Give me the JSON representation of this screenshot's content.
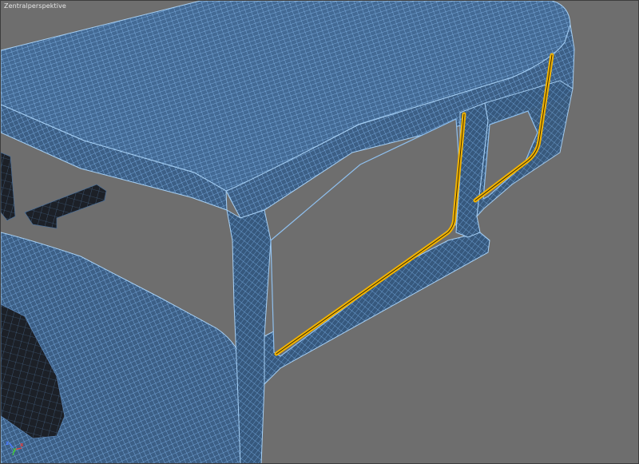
{
  "viewport": {
    "label": "Zentralperspektive"
  },
  "axis_gizmo": {
    "x_label": "x",
    "y_label": "y",
    "z_label": "z"
  },
  "colors": {
    "background": "#6e6e6e",
    "wireframe": "#5d9ad8",
    "selection": "#f2b300",
    "mesh_dark": "#1c1f24"
  }
}
